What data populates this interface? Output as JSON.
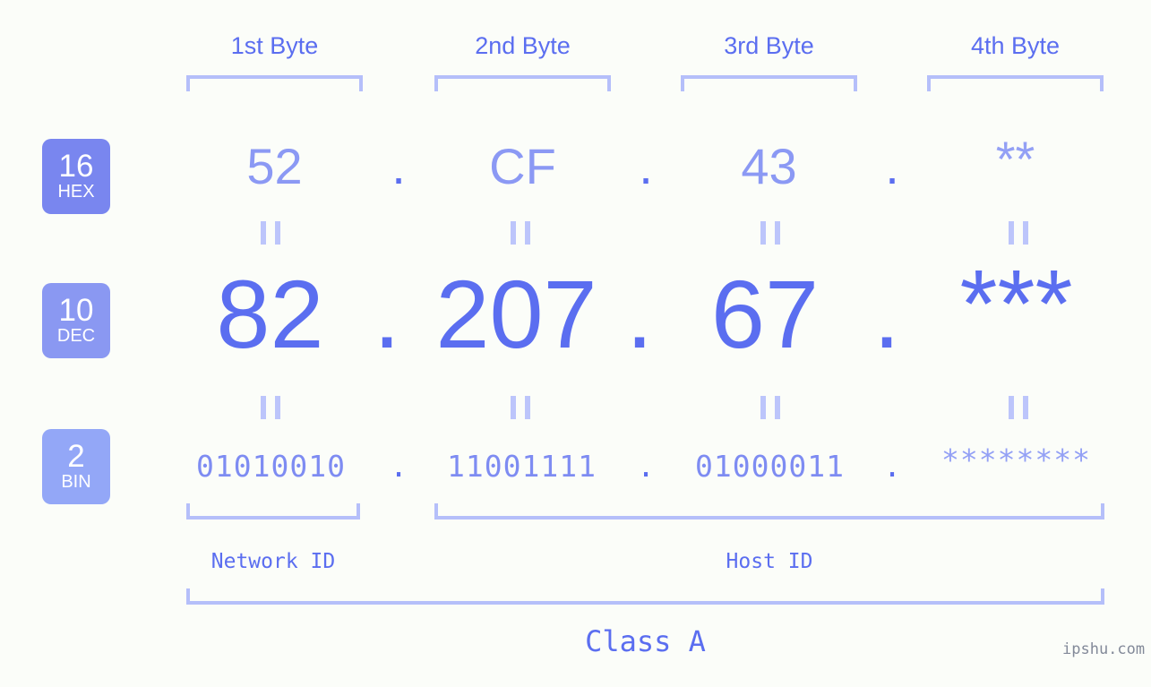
{
  "page": {
    "background_color": "#fbfdf9",
    "accent_color": "#5b6ef0",
    "accent_light_color": "#b5bffa",
    "watermark": "ipshu.com"
  },
  "byte_headers": [
    {
      "label": "1st Byte"
    },
    {
      "label": "2nd Byte"
    },
    {
      "label": "3rd Byte"
    },
    {
      "label": "4th Byte"
    }
  ],
  "rows": {
    "hex": {
      "badge_number": "16",
      "badge_abbr": "HEX",
      "badge_color": "#7986ef",
      "values": [
        "52",
        "CF",
        "43",
        "**"
      ],
      "separator": "."
    },
    "dec": {
      "badge_number": "10",
      "badge_abbr": "DEC",
      "badge_color": "#8a98f2",
      "values": [
        "82",
        "207",
        "67",
        "***"
      ],
      "separator": "."
    },
    "bin": {
      "badge_number": "2",
      "badge_abbr": "BIN",
      "badge_color": "#93a7f7",
      "values": [
        "01010010",
        "11001111",
        "01000011",
        "********"
      ],
      "separator": "."
    }
  },
  "equality_marks": {
    "glyph": "=",
    "count_per_gap": 4
  },
  "id_sections": [
    {
      "label": "Network ID"
    },
    {
      "label": "Host ID"
    }
  ],
  "class_section": {
    "label": "Class A"
  }
}
